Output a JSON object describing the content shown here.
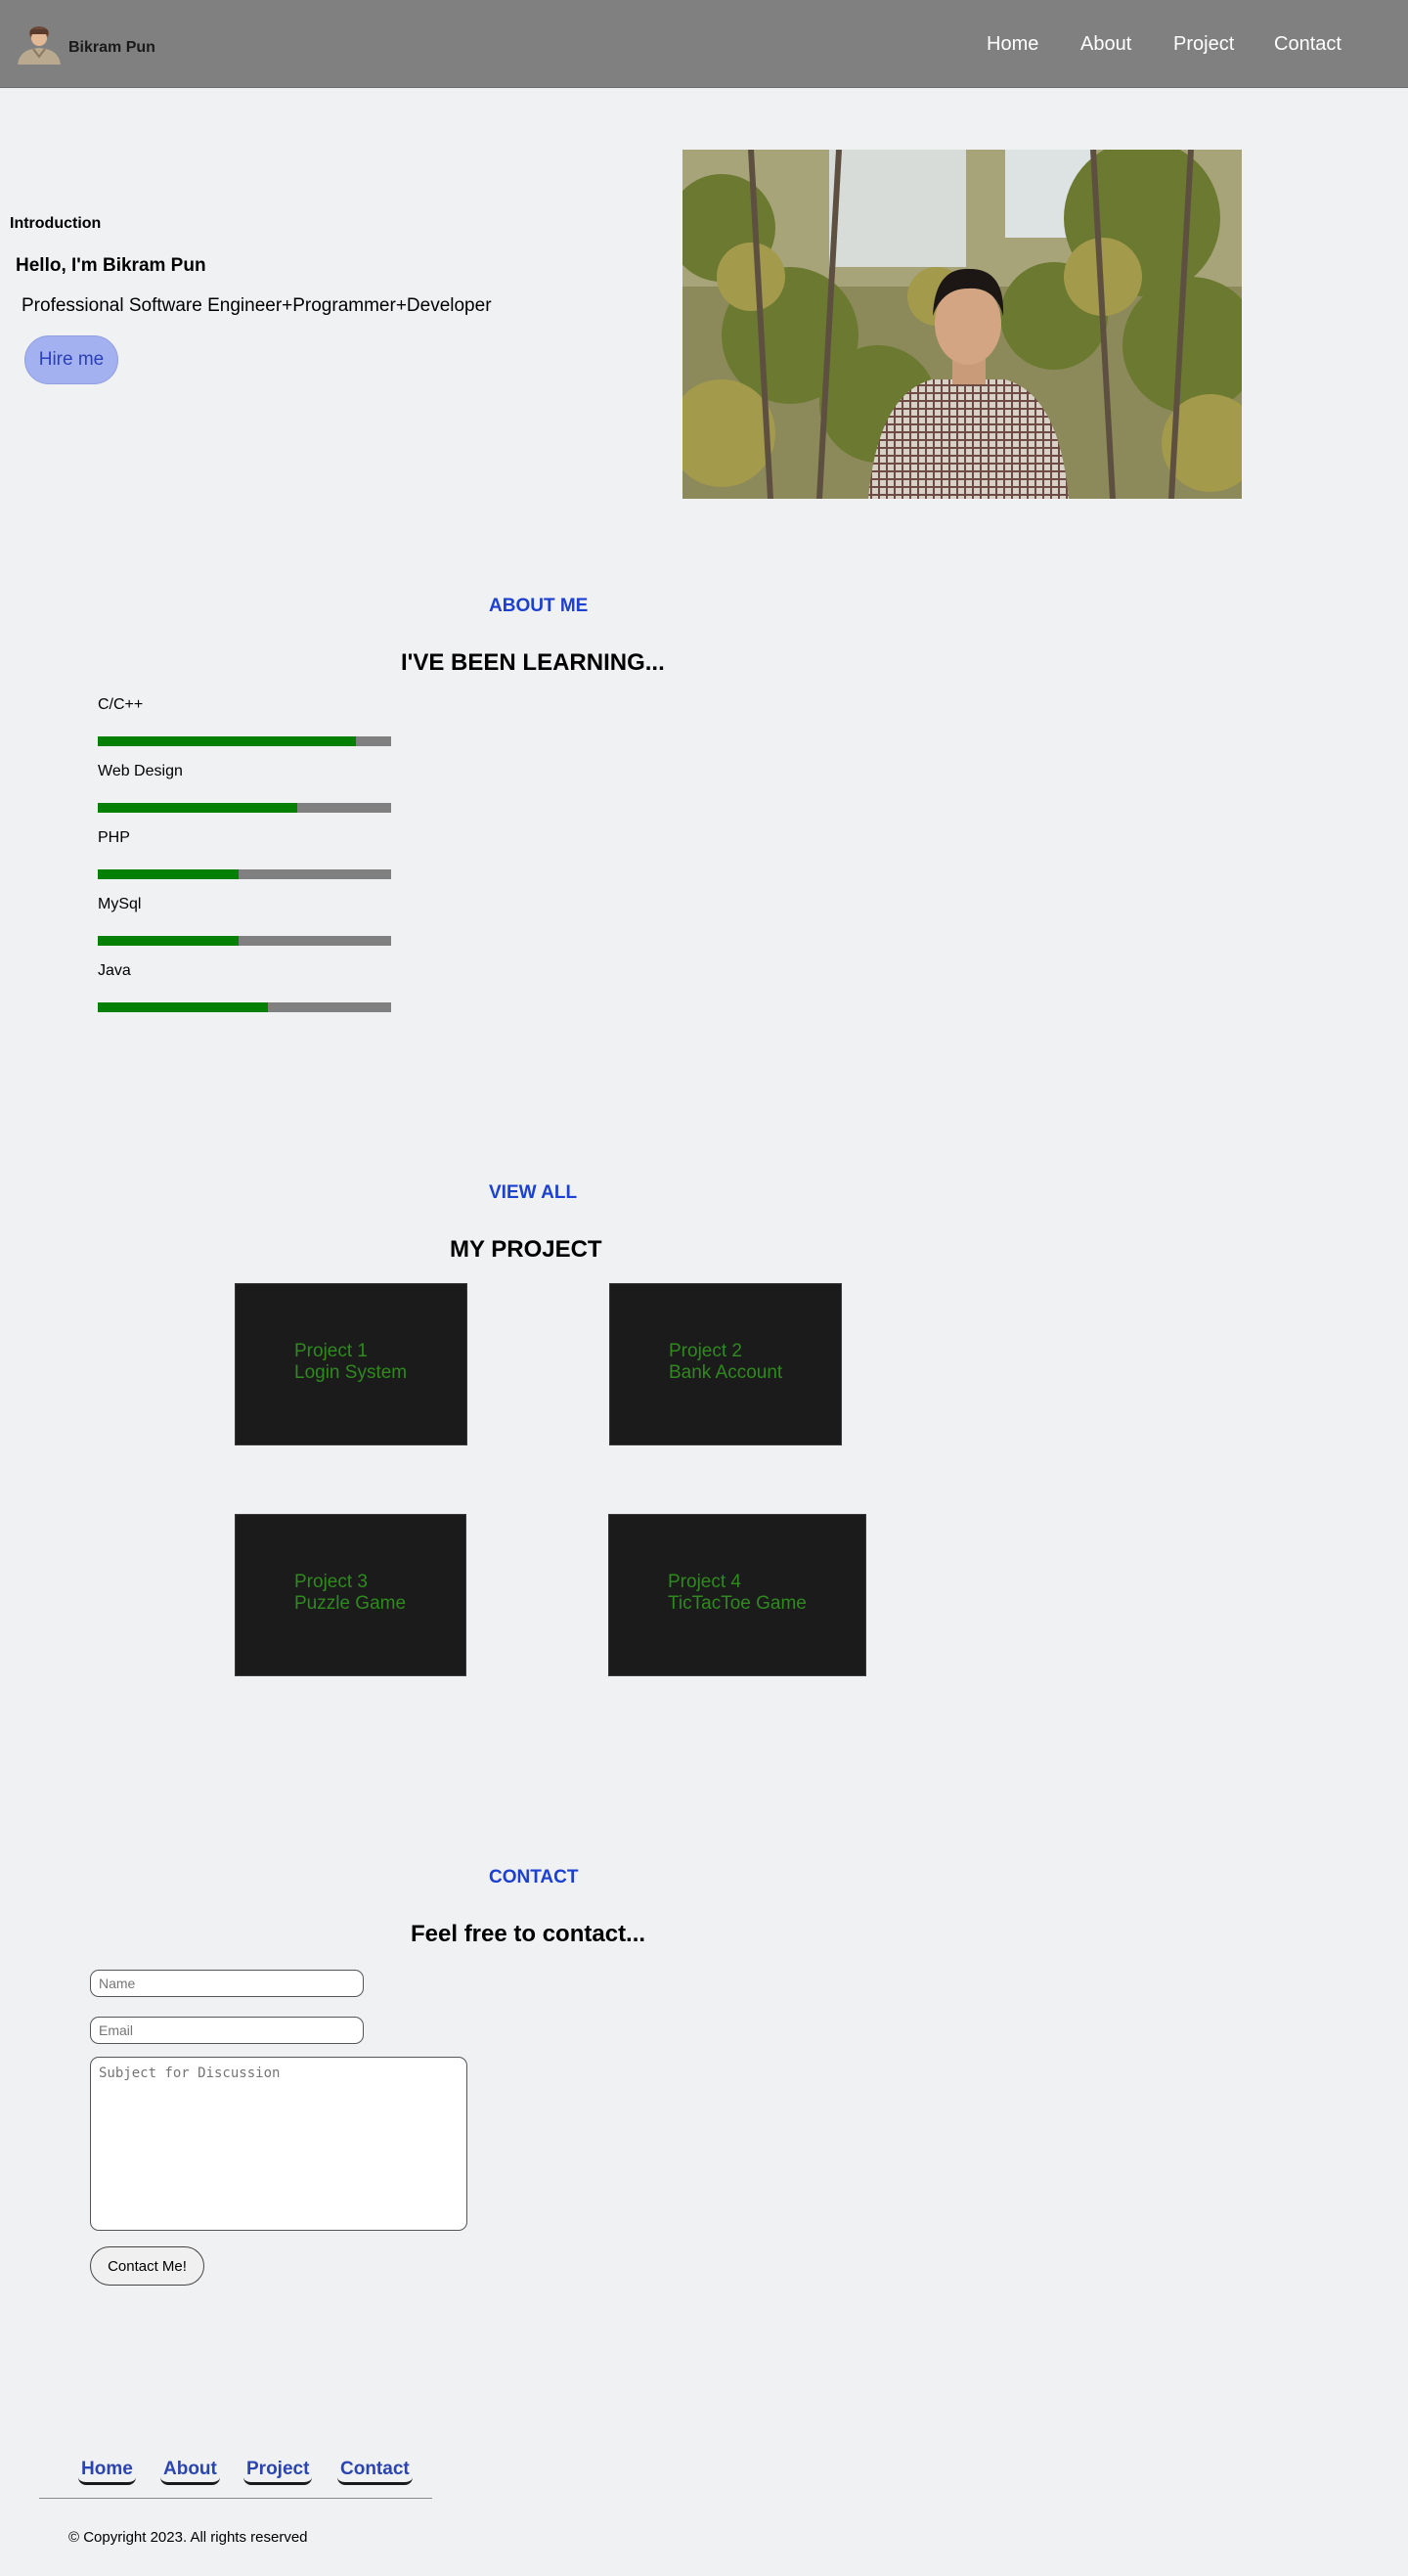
{
  "header": {
    "brand": "Bikram Pun",
    "nav": [
      "Home",
      "About",
      "Project",
      "Contact"
    ]
  },
  "intro": {
    "label": "Introduction",
    "hello": "Hello, I'm Bikram Pun",
    "role": "Professional Software Engineer+Programmer+Developer",
    "hire_button": "Hire me"
  },
  "about": {
    "tag": "ABOUT ME",
    "title": "I'VE BEEN LEARNING...",
    "skills": [
      {
        "name": "C/C++",
        "level": 0.88
      },
      {
        "name": "Web Design",
        "level": 0.68
      },
      {
        "name": "PHP",
        "level": 0.48
      },
      {
        "name": "MySql",
        "level": 0.48
      },
      {
        "name": "Java",
        "level": 0.58
      }
    ]
  },
  "projects": {
    "tag": "VIEW ALL",
    "title": "MY PROJECT",
    "items": [
      {
        "number": "Project 1",
        "name": "Login System"
      },
      {
        "number": "Project 2",
        "name": "Bank Account"
      },
      {
        "number": "Project 3",
        "name": "Puzzle Game"
      },
      {
        "number": "Project 4",
        "name": "TicTacToe Game"
      }
    ]
  },
  "contact": {
    "tag": "CONTACT",
    "title": "Feel free to contact...",
    "name_placeholder": "Name",
    "email_placeholder": "Email",
    "subject_placeholder": "Subject for Discussion",
    "button": "Contact Me!"
  },
  "footer": {
    "links": [
      "Home",
      "About",
      "Project",
      "Contact"
    ],
    "copyright": "© Copyright 2023. All rights reserved"
  },
  "colors": {
    "header_bg": "#808080",
    "accent_blue": "#1c40d0",
    "bar_fill": "#058005",
    "bar_track": "#808080",
    "project_card": "#1b1b1b",
    "project_text": "#2f8a1e"
  }
}
